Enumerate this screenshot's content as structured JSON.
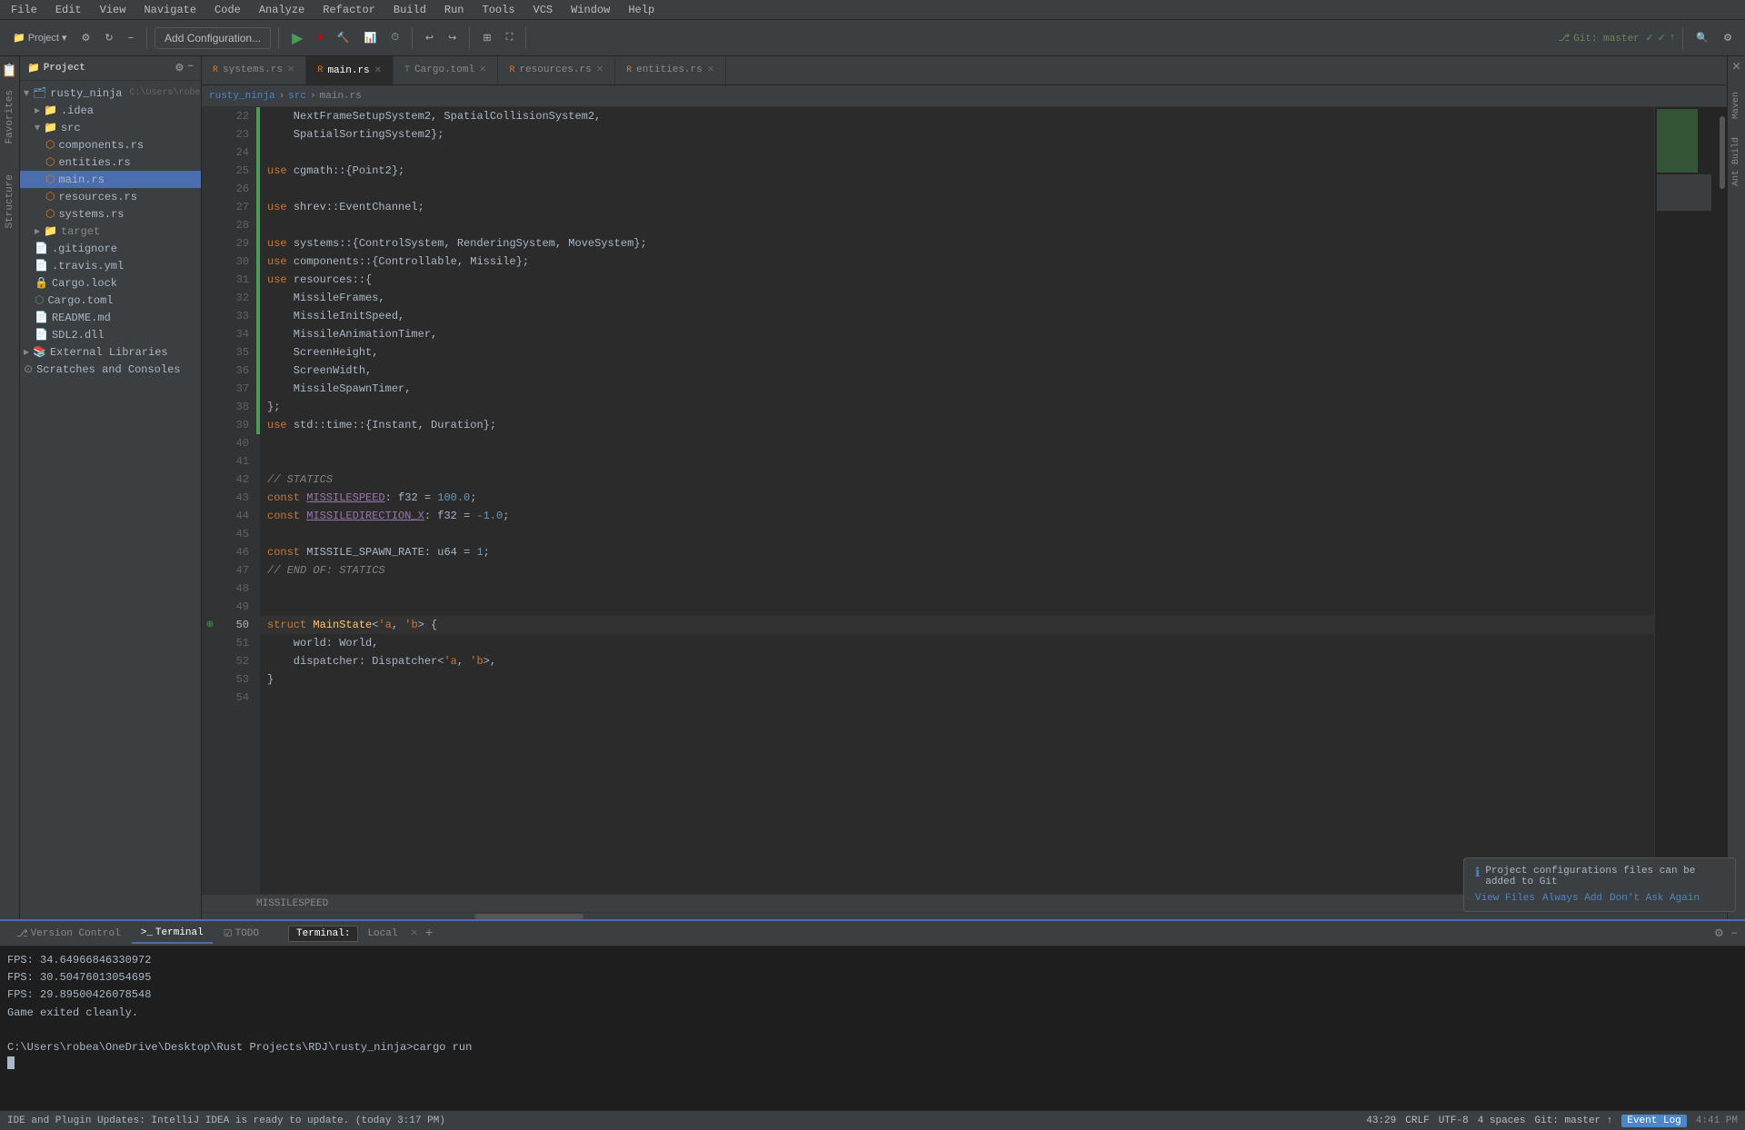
{
  "app": {
    "title": "rusty_ninja",
    "menu_items": [
      "File",
      "Edit",
      "View",
      "Navigate",
      "Code",
      "Analyze",
      "Refactor",
      "Build",
      "Run",
      "Tools",
      "VCS",
      "Window",
      "Help"
    ]
  },
  "toolbar": {
    "project_label": "Project",
    "add_config_label": "Add Configuration...",
    "git_label": "Git: master ✓",
    "run_icon": "▶",
    "debug_icon": "🐛"
  },
  "sidebar": {
    "title": "Project",
    "tree": [
      {
        "label": "rusty_ninja",
        "level": 1,
        "type": "project",
        "expanded": true
      },
      {
        "label": ".idea",
        "level": 2,
        "type": "folder",
        "expanded": false
      },
      {
        "label": "src",
        "level": 2,
        "type": "folder",
        "expanded": true
      },
      {
        "label": "components.rs",
        "level": 3,
        "type": "rs"
      },
      {
        "label": "entities.rs",
        "level": 3,
        "type": "rs"
      },
      {
        "label": "main.rs",
        "level": 3,
        "type": "rs",
        "active": true
      },
      {
        "label": "resources.rs",
        "level": 3,
        "type": "rs"
      },
      {
        "label": "systems.rs",
        "level": 3,
        "type": "rs"
      },
      {
        "label": "target",
        "level": 2,
        "type": "folder",
        "expanded": false
      },
      {
        "label": ".gitignore",
        "level": 2,
        "type": "file"
      },
      {
        "label": ".travis.yml",
        "level": 2,
        "type": "yaml"
      },
      {
        "label": "Cargo.lock",
        "level": 2,
        "type": "file"
      },
      {
        "label": "Cargo.toml",
        "level": 2,
        "type": "toml"
      },
      {
        "label": "README.md",
        "level": 2,
        "type": "md"
      },
      {
        "label": "SDL2.dll",
        "level": 2,
        "type": "dll"
      },
      {
        "label": "External Libraries",
        "level": 1,
        "type": "folder",
        "expanded": false
      },
      {
        "label": "Scratches and Consoles",
        "level": 1,
        "type": "folder"
      }
    ]
  },
  "tabs": [
    {
      "label": "systems.rs",
      "type": "rs",
      "modified": false,
      "active": false
    },
    {
      "label": "main.rs",
      "type": "rs",
      "modified": false,
      "active": true
    },
    {
      "label": "Cargo.toml",
      "type": "toml",
      "modified": false,
      "active": false
    },
    {
      "label": "resources.rs",
      "type": "rs",
      "modified": false,
      "active": false
    },
    {
      "label": "entities.rs",
      "type": "rs",
      "modified": false,
      "active": false
    }
  ],
  "editor": {
    "filename": "main.rs",
    "breadcrumb": "rusty_ninja > src > main.rs",
    "lines": [
      {
        "num": 22,
        "content": "    NextFrameSetupSystem2, SpatialCollisionSystem2,",
        "green": true
      },
      {
        "num": 23,
        "content": "    SpatialSortingSystem2};",
        "green": true
      },
      {
        "num": 24,
        "content": ""
      },
      {
        "num": 25,
        "content": "use cgmath::{Point2};",
        "green": true
      },
      {
        "num": 26,
        "content": ""
      },
      {
        "num": 27,
        "content": "use shrev::EventChannel;",
        "green": true
      },
      {
        "num": 28,
        "content": ""
      },
      {
        "num": 29,
        "content": "use systems::{ControlSystem, RenderingSystem, MoveSystem};",
        "green": true
      },
      {
        "num": 30,
        "content": "use components::{Controllable, Missile};",
        "green": true
      },
      {
        "num": 31,
        "content": "use resources::{",
        "green": true
      },
      {
        "num": 32,
        "content": "    MissileFrames,",
        "green": true
      },
      {
        "num": 33,
        "content": "    MissileInitSpeed,",
        "green": true
      },
      {
        "num": 34,
        "content": "    MissileAnimationTimer,",
        "green": true
      },
      {
        "num": 35,
        "content": "    ScreenHeight,",
        "green": true
      },
      {
        "num": 36,
        "content": "    ScreenWidth,",
        "green": true
      },
      {
        "num": 37,
        "content": "    MissileSpawnTimer,",
        "green": true
      },
      {
        "num": 38,
        "content": "};",
        "green": true
      },
      {
        "num": 39,
        "content": "use std::time::{Instant, Duration};",
        "green": true
      },
      {
        "num": 40,
        "content": ""
      },
      {
        "num": 41,
        "content": ""
      },
      {
        "num": 42,
        "content": "// STATICS",
        "comment": true
      },
      {
        "num": 43,
        "content": "const MISSILESPEED: f32 = 100.0;"
      },
      {
        "num": 44,
        "content": "const MISSILEDIRECTION_X: f32 = -1.0;"
      },
      {
        "num": 45,
        "content": ""
      },
      {
        "num": 46,
        "content": "const MISSILE_SPAWN_RATE: u64 = 1;"
      },
      {
        "num": 47,
        "content": "// END OF: STATICS",
        "comment": true
      },
      {
        "num": 48,
        "content": ""
      },
      {
        "num": 49,
        "content": ""
      },
      {
        "num": 50,
        "content": "struct MainState<'a, 'b> {",
        "has_icon": true
      },
      {
        "num": 51,
        "content": "    world: World,"
      },
      {
        "num": 52,
        "content": "    dispatcher: Dispatcher<'a, 'b>,"
      },
      {
        "num": 53,
        "content": "}"
      },
      {
        "num": 54,
        "content": ""
      }
    ],
    "scroll_indicator": "MISSILESPEED"
  },
  "terminal": {
    "tabs": [
      {
        "label": "Terminal",
        "active": true
      },
      {
        "label": "Local",
        "active": false
      }
    ],
    "lines": [
      "FPS: 34.64966846330972",
      "FPS: 30.50476013054695",
      "FPS: 29.89500426078548",
      "Game exited cleanly.",
      "",
      "C:\\Users\\robea\\OneDrive\\Desktop\\Rust Projects\\RDJ\\rusty_ninja>cargo run"
    ],
    "cursor_line": "C:\\Users\\robea\\OneDrive\\Desktop\\Rust Projects\\RDJ\\rusty_ninja>cargo run"
  },
  "bottom_tabs": [
    {
      "label": "Version Control",
      "icon": "⎇",
      "active": false
    },
    {
      "label": "Terminal",
      "icon": ">",
      "active": true
    },
    {
      "label": "TODO",
      "icon": "☑",
      "active": false
    }
  ],
  "notification": {
    "text": "Project configurations files can be added to Git",
    "actions": [
      "View Files",
      "Always Add",
      "Don't Ask Again"
    ]
  },
  "status_bar": {
    "message": "IDE and Plugin Updates: IntelliJ IDEA is ready to update. (today 3:17 PM)",
    "position": "43:29",
    "line_sep": "CRLF",
    "encoding": "UTF-8",
    "indent": "4 spaces",
    "git": "Git: master ↑",
    "event_log": "Event Log",
    "time": "4:41 PM"
  }
}
